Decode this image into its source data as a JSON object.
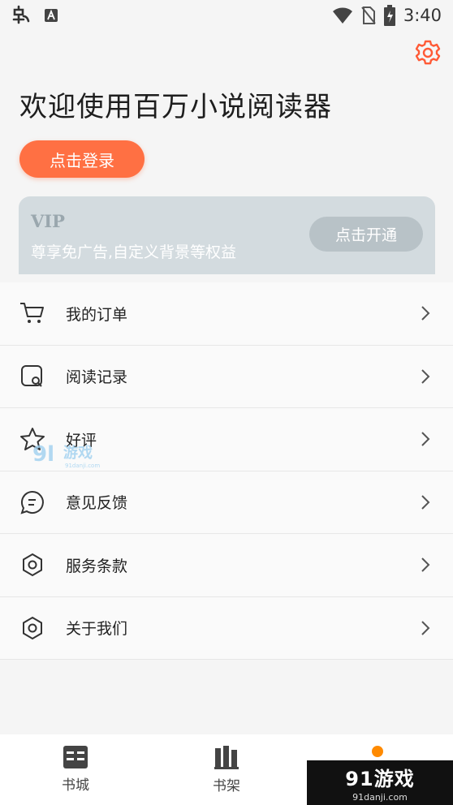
{
  "status": {
    "time": "3:40"
  },
  "header": {
    "welcome": "欢迎使用百万小说阅读器",
    "login_label": "点击登录"
  },
  "vip": {
    "title": "VIP",
    "desc": "尊享免广告,自定义背景等权益",
    "button": "点击开通"
  },
  "menu": [
    {
      "label": "我的订单",
      "icon": "cart-icon"
    },
    {
      "label": "阅读记录",
      "icon": "history-icon"
    },
    {
      "label": "好评",
      "icon": "star-icon"
    },
    {
      "label": "意见反馈",
      "icon": "feedback-icon"
    },
    {
      "label": "服务条款",
      "icon": "hexagon-icon"
    },
    {
      "label": "关于我们",
      "icon": "hexagon-icon"
    }
  ],
  "watermark": {
    "text": "91游戏",
    "sub": "91danji.com"
  },
  "nav": [
    {
      "label": "书城",
      "icon": "bookstore-icon"
    },
    {
      "label": "书架",
      "icon": "bookshelf-icon"
    },
    {
      "label": "",
      "icon": "mine-icon"
    }
  ],
  "corner_logo": {
    "text": "91游戏",
    "sub": "91danji.com"
  },
  "colors": {
    "accent": "#ff7043",
    "vip_bg": "#d3dbdf",
    "dot": "#ff8a00"
  }
}
